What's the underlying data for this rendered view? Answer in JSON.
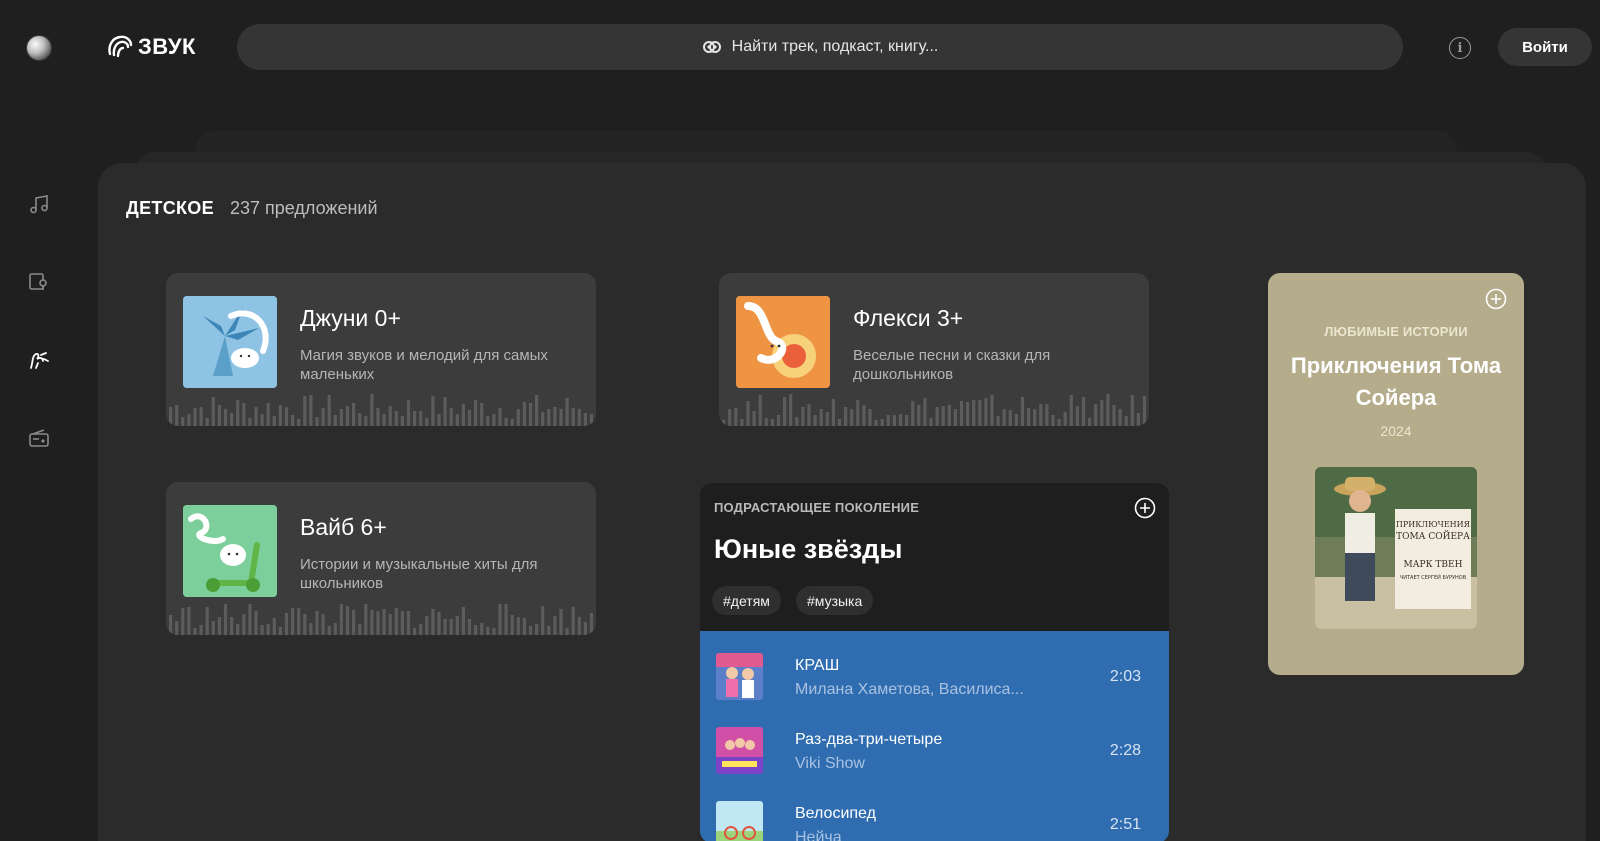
{
  "header": {
    "logo_text": "ЗВУК",
    "search_placeholder": "Найти трек, подкаст, книгу...",
    "login_label": "Войти",
    "info_glyph": "i"
  },
  "sidebar": {
    "items": [
      {
        "icon": "music-note-icon"
      },
      {
        "icon": "podcast-icon"
      },
      {
        "icon": "kids-icon"
      },
      {
        "icon": "radio-icon"
      }
    ]
  },
  "section": {
    "title": "ДЕТСКОЕ",
    "count": "237 предложений"
  },
  "age_cards": [
    {
      "title": "Джуни 0+",
      "desc": "Магия звуков и мелодий для самых маленьких"
    },
    {
      "title": "Флекси 3+",
      "desc": "Веселые песни и сказки для дошкольников"
    },
    {
      "title": "Вайб 6+",
      "desc": "Истории и музыкальные хиты для школьников"
    }
  ],
  "playlist": {
    "eyebrow": "ПОДРАСТАЮЩЕЕ ПОКОЛЕНИЕ",
    "title": "Юные звёзды",
    "tags": [
      "#детям",
      "#музыка"
    ],
    "tracks": [
      {
        "title": "КРАШ",
        "artist": "Милана Хаметова, Василиса...",
        "duration": "2:03"
      },
      {
        "title": "Раз-два-три-четыре",
        "artist": "Viki Show",
        "duration": "2:28"
      },
      {
        "title": "Велосипед",
        "artist": "Нейча",
        "duration": "2:51"
      }
    ]
  },
  "book": {
    "eyebrow": "ЛЮБИМЫЕ ИСТОРИИ",
    "title": "Приключения Тома Сойера",
    "year": "2024",
    "cover_text": [
      "ПРИКЛЮЧЕНИЯ",
      "ТОМА СОЙЕРА",
      "МАРК ТВЕН",
      "ЧИТАЕТ СЕРГЕЙ БУРУНОВ"
    ]
  },
  "colors": {
    "background": "#1f1f1f",
    "panel": "#2b2b2b",
    "card": "#3c3c3c",
    "tracks_bg": "#2f6db0",
    "book_bg": "#b5ac8b"
  }
}
